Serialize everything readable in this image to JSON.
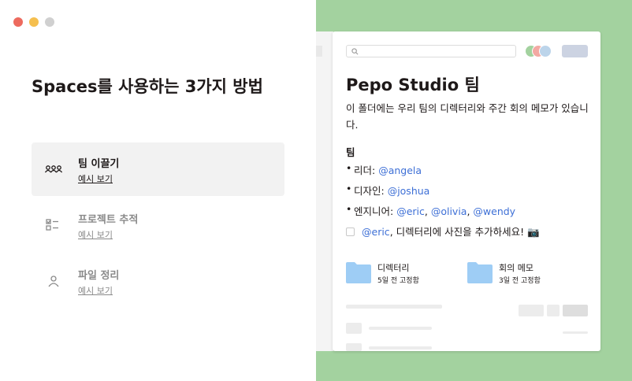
{
  "left_panel": {
    "headline": "Spaces를 사용하는 3가지 방법",
    "items": [
      {
        "title": "팀 이끌기",
        "link": "예시 보기",
        "icon": "people-icon",
        "active": true
      },
      {
        "title": "프로젝트 추적",
        "link": "예시 보기",
        "icon": "checklist-icon",
        "active": false
      },
      {
        "title": "파일 정리",
        "link": "예시 보기",
        "icon": "person-icon",
        "active": false
      }
    ]
  },
  "preview": {
    "title": "Pepo Studio 팀",
    "description": "이 폴더에는 우리 팀의 디렉터리와 주간 회의 메모가 있습니다.",
    "section": "팀",
    "bullets": [
      {
        "label": "리더: ",
        "mentions": [
          "@angela"
        ]
      },
      {
        "label": "디자인: ",
        "mentions": [
          "@joshua"
        ]
      },
      {
        "label": "엔지니어: ",
        "mentions": [
          "@eric",
          "@olivia",
          "@wendy"
        ]
      }
    ],
    "todo": {
      "mention": "@eric",
      "text": ", 디렉터리에 사진을 추가하세요! 📷"
    },
    "folders": [
      {
        "name": "디렉터리",
        "meta": "5일 전 고정함"
      },
      {
        "name": "회의 메모",
        "meta": "3일 전 고정함"
      }
    ]
  },
  "colors": {
    "accent_bg": "#a3d29f",
    "mention": "#3d6fd6",
    "folder": "#9ecdf5"
  }
}
